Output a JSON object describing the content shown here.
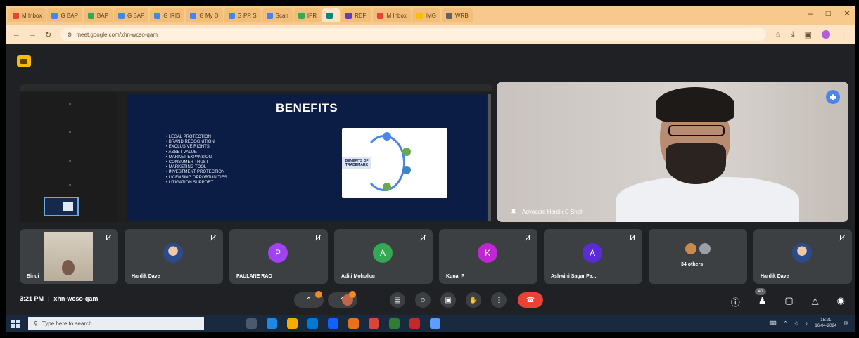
{
  "browser": {
    "tabs": [
      {
        "label": "M Inbox",
        "color": "#ea4335"
      },
      {
        "label": "G BAP",
        "color": "#4285f4"
      },
      {
        "label": "BAP",
        "color": "#34a853"
      },
      {
        "label": "G BAP",
        "color": "#4285f4"
      },
      {
        "label": "G IRIS",
        "color": "#4285f4"
      },
      {
        "label": "G My D",
        "color": "#4285f4"
      },
      {
        "label": "G PR S",
        "color": "#4285f4"
      },
      {
        "label": "Scan",
        "color": "#4285f4"
      },
      {
        "label": "IPR",
        "color": "#34a853"
      },
      {
        "label": "",
        "color": "#00897b"
      },
      {
        "label": "REFI",
        "color": "#673ab7"
      },
      {
        "label": "M Inbox",
        "color": "#ea4335"
      },
      {
        "label": "IMG",
        "color": "#fbbc04"
      },
      {
        "label": "WRB",
        "color": "#5f6368"
      }
    ],
    "active_tab_index": 9,
    "url": "meet.google.com/xhn-wcso-qam",
    "window_controls": [
      "–",
      "□",
      "✕"
    ],
    "nav_glyphs": [
      "←",
      "→",
      "↻"
    ],
    "addr_right_glyphs": [
      "☆",
      "⤓",
      "▣",
      "⋮"
    ],
    "profile_color": "#b45cd8"
  },
  "slide": {
    "title": "BENEFITS",
    "bullets": [
      "LEGAL PROTECTION",
      "BRAND RECOGNITION",
      "EXCLUSIVE RIGHTS",
      "ASSET VALUE",
      "MARKET EXPANSION",
      "CONSUMER TRUST",
      "MARKETING TOOL",
      "INVESTMENT PROTECTION",
      "LICENSING OPPORTUNITIES",
      "LITIGATION SUPPORT"
    ],
    "diagram_label": "BENEFITS OF TRADEMARK"
  },
  "speaker": {
    "name": "Advocate Hardik C Shah"
  },
  "participants": [
    {
      "name": "Bindi",
      "type": "video"
    },
    {
      "name": "Hardik Dave",
      "type": "photo"
    },
    {
      "name": "PAULANE RAO",
      "type": "letter",
      "initial": "P",
      "color": "#a142f4"
    },
    {
      "name": "Aditi Moholkar",
      "type": "letter",
      "initial": "A",
      "color": "#34a853"
    },
    {
      "name": "Kunal P",
      "type": "letter",
      "initial": "K",
      "color": "#c026d3"
    },
    {
      "name": "Ashwini Sagar Pa...",
      "type": "letter",
      "initial": "A",
      "color": "#5b2bd6"
    },
    {
      "name": "34 others",
      "type": "others"
    },
    {
      "name": "Hardik Dave",
      "type": "photo"
    }
  ],
  "meeting": {
    "time": "3:21 PM",
    "code": "xhn-wcso-qam",
    "people_count": "40"
  },
  "taskbar": {
    "search_placeholder": "Type here to search",
    "time": "15:21",
    "date": "16-04-2024"
  },
  "colors": {
    "end_call": "#ea4335",
    "slide_bg": "#0c1d45",
    "tab_strip": "#f7c98c"
  }
}
